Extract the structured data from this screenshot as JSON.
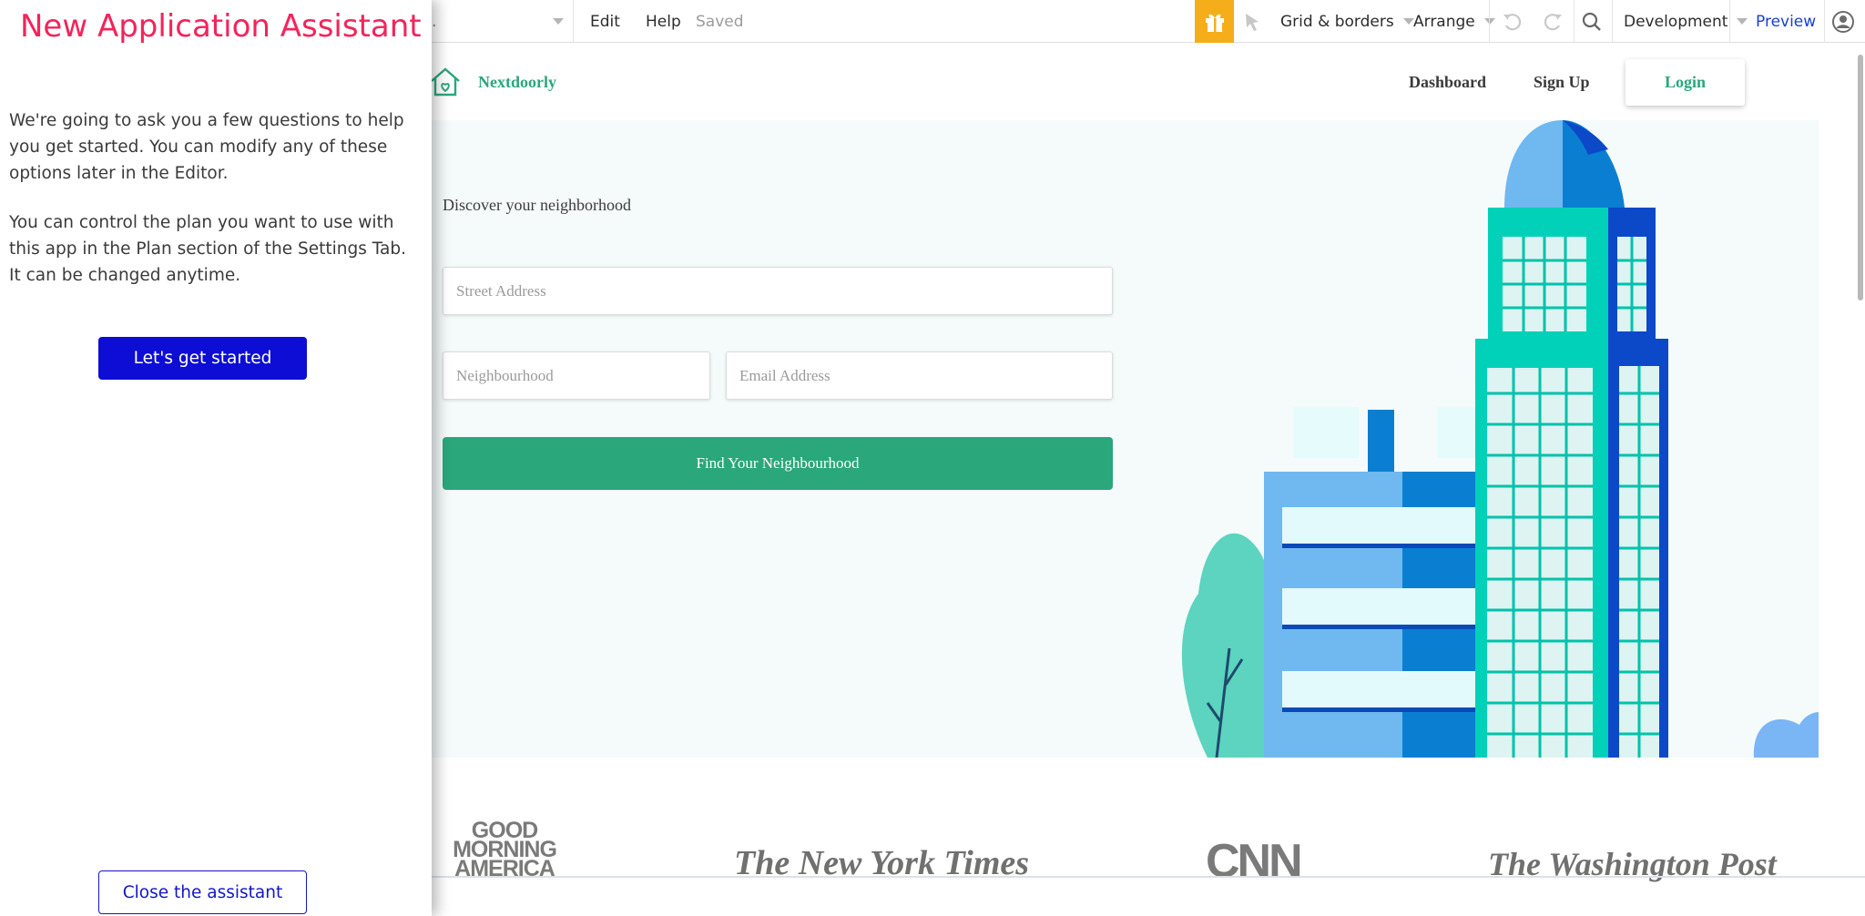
{
  "toolbar": {
    "edit": "Edit",
    "help": "Help",
    "saved": "Saved",
    "grid_borders": "Grid & borders",
    "arrange": "Arrange",
    "development": "Development",
    "preview": "Preview",
    "gift_color": "#f6ad1a",
    "preview_color": "#1a3fd0"
  },
  "assistant": {
    "title": "New Application Assistant",
    "intro": "We're going to ask you a few questions to help you get started. You can modify any of these options later in the Editor.",
    "plan_note": "You can control the plan you want to use with this app in the Plan section of the Settings Tab. It can be changed anytime.",
    "start_button": "Let's get started",
    "close_button": "Close the assistant",
    "title_color": "#f3245b",
    "button_color": "#0d0dd6"
  },
  "site": {
    "brand": "Nextdoorly",
    "nav": {
      "dashboard": "Dashboard",
      "signup": "Sign Up",
      "login": "Login"
    },
    "tagline": "Discover your neighborhood",
    "street_placeholder": "Street Address",
    "neighbourhood_placeholder": "Neighbourhood",
    "email_placeholder": "Email Address",
    "find_button": "Find Your Neighbourhood",
    "accent": "#2aa77b",
    "press": {
      "gma_line1": "GOOD",
      "gma_line2": "MORNING",
      "gma_line3": "AMERICA",
      "nyt": "The New York Times",
      "cnn": "CNN",
      "wapo": "The Washington Post"
    }
  }
}
